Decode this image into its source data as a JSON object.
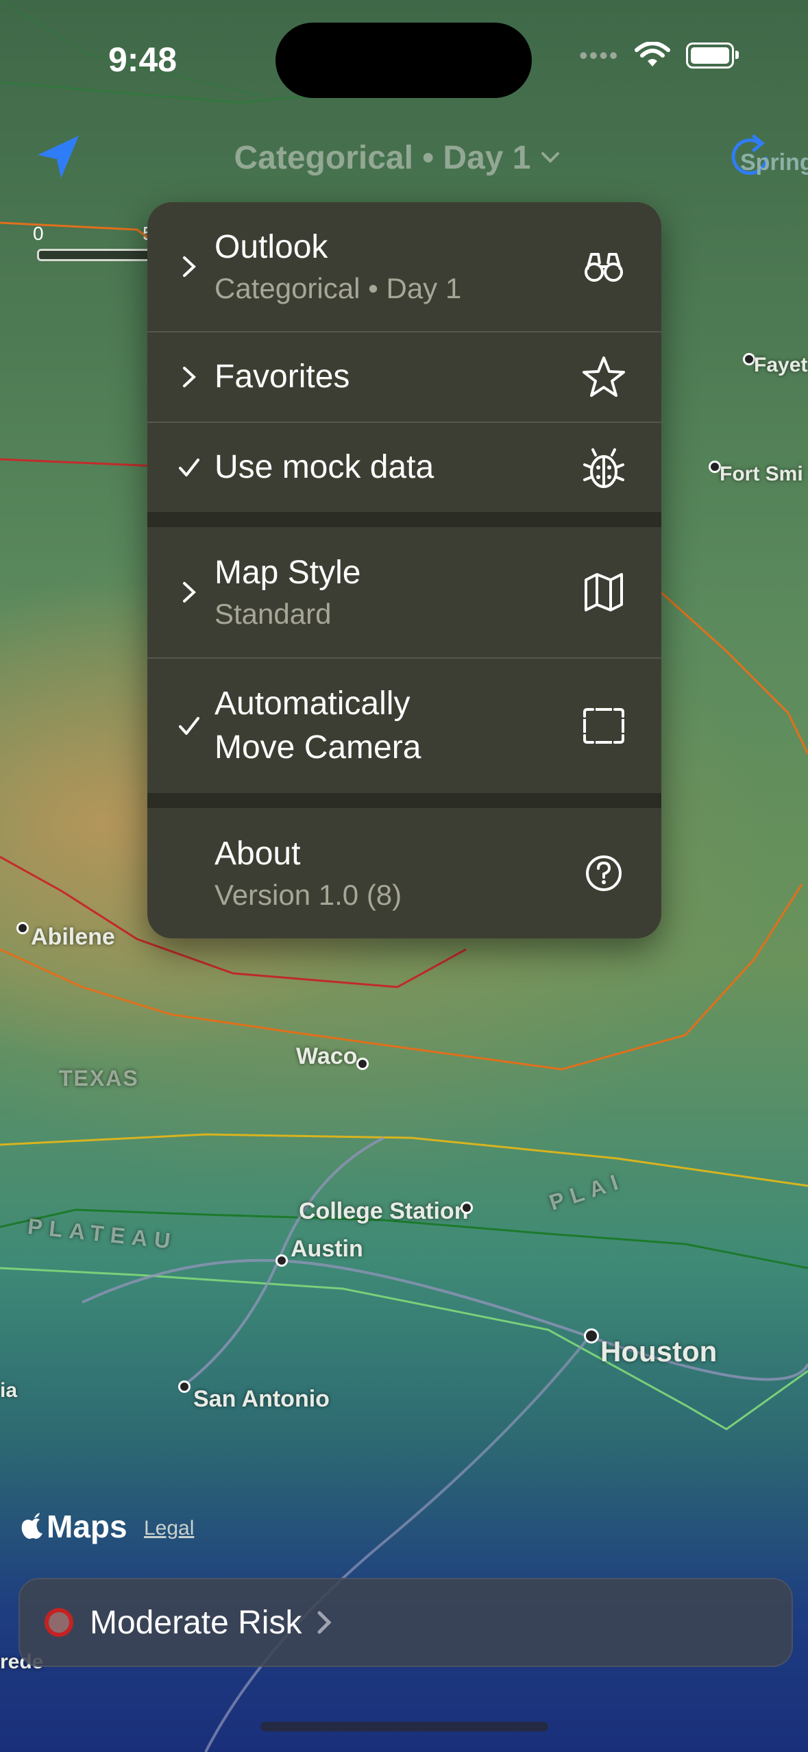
{
  "status_bar": {
    "time": "9:48"
  },
  "nav": {
    "title": "Categorical • Day 1",
    "right_button_label": "Spring"
  },
  "scale": {
    "labels": [
      "0",
      "5"
    ]
  },
  "map": {
    "places": {
      "abilene": "Abilene",
      "waco": "Waco",
      "texas": "TEXAS",
      "college_station": "College Station",
      "austin": "Austin",
      "houston": "Houston",
      "san_antonio": "San Antonio",
      "fayette": "Fayet",
      "fort_smith": "Fort Smi",
      "left_cut": "ia",
      "bottom_cut": "rede"
    },
    "plateau_letters": "PLATEAU",
    "plains_letters": "PLAI"
  },
  "menu": {
    "outlook": {
      "title": "Outlook",
      "subtitle": "Categorical • Day 1",
      "icon": "binoculars-icon"
    },
    "favorites": {
      "title": "Favorites",
      "icon": "star-icon"
    },
    "mock_data": {
      "title": "Use mock data",
      "checked": true,
      "icon": "ladybug-icon"
    },
    "map_style": {
      "title": "Map Style",
      "subtitle": "Standard",
      "icon": "map-icon"
    },
    "auto_camera": {
      "title_line1": "Automatically",
      "title_line2": "Move Camera",
      "checked": true,
      "icon": "viewfinder-icon"
    },
    "about": {
      "title": "About",
      "subtitle": "Version 1.0 (8)",
      "icon": "question-circle-icon"
    }
  },
  "footer": {
    "maps_brand": "Maps",
    "legal": "Legal",
    "risk_label": "Moderate Risk",
    "risk_color": "#c42222"
  }
}
